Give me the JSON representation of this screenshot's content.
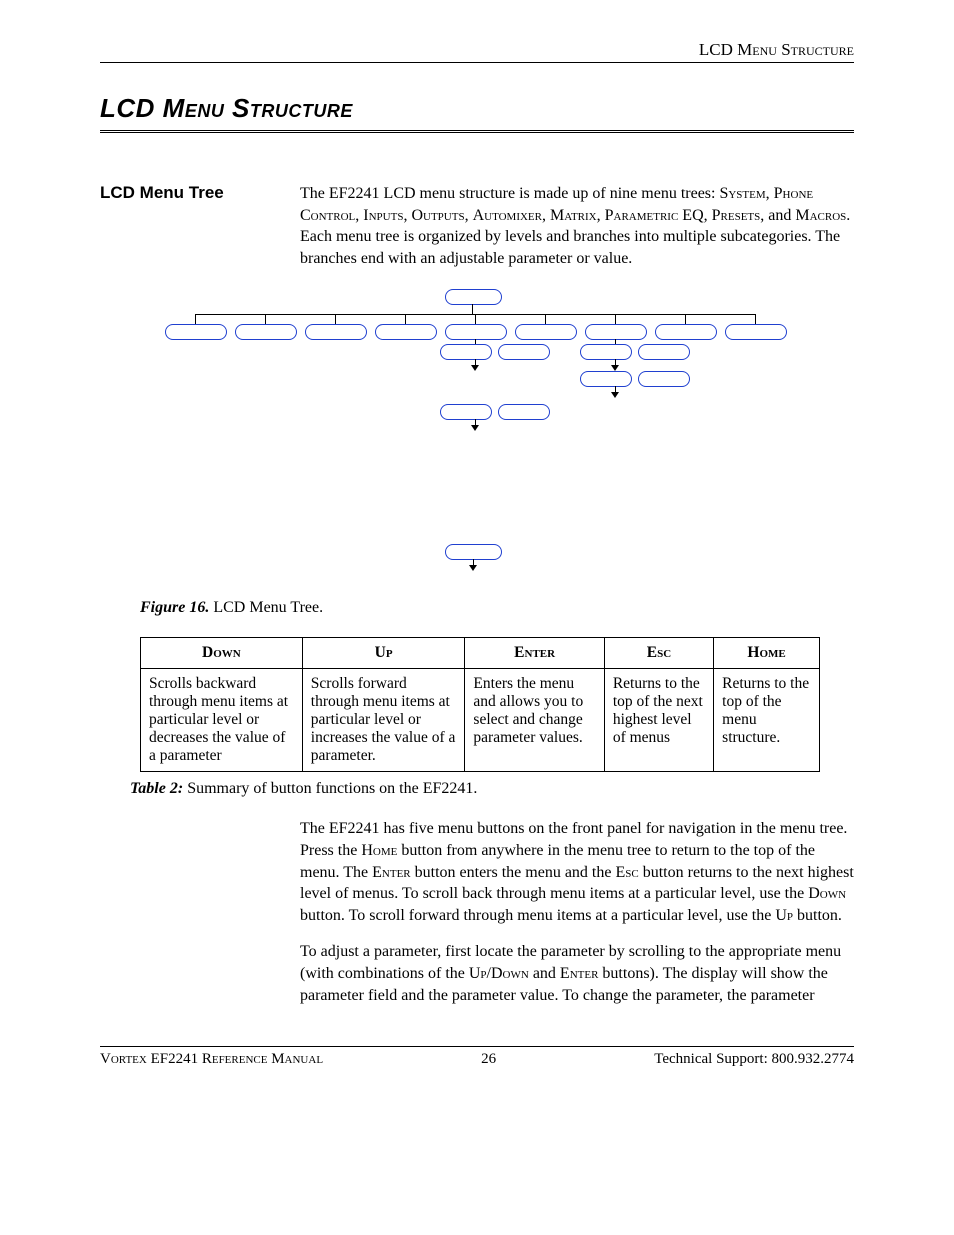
{
  "header": {
    "running_head": "LCD Menu Structure"
  },
  "chapter": {
    "title": "LCD Menu Structure"
  },
  "menu_tree": {
    "label": "LCD Menu Tree",
    "para_before_list": "The EF2241 LCD menu structure is made up of nine menu trees: ",
    "trees": [
      "System",
      "Phone Control",
      "Inputs",
      "Outputs",
      "Automixer",
      "Matrix",
      "Parametric EQ",
      "Presets",
      "Macros"
    ],
    "para_after_list": ".  Each menu tree is organized by levels and branches into multiple subcategories.  The branches end with an adjustable parameter or value."
  },
  "figure": {
    "label": "Figure 16.",
    "caption": " LCD Menu Tree."
  },
  "table": {
    "headers": [
      "Down",
      "Up",
      "Enter",
      "Esc",
      "Home"
    ],
    "cells": [
      "Scrolls backward through menu items at particular level or decreases the value of a parameter",
      "Scrolls forward through menu items at particular level or increases the value of a parameter.",
      "Enters the menu and allows you to select and change parameter values.",
      "Returns to the top of the next highest level of menus",
      "Returns to the top of the menu structure."
    ],
    "caption_label": "Table 2:",
    "caption_text": " Summary of button functions on the EF2241."
  },
  "paragraphs": {
    "p1a": "The EF2241 has five menu buttons on the front panel for navigation in the menu tree.  Press the ",
    "p1_home": "Home",
    "p1b": " button from anywhere in the menu tree to return to the top of the menu.  The ",
    "p1_enter": "Enter",
    "p1c": " button enters the menu and the ",
    "p1_esc": "Esc",
    "p1d": " button returns to the next highest level of menus.  To scroll back through menu items at a particular level, use the ",
    "p1_down": "Down",
    "p1e": " button.  To scroll forward through menu items at a particular level, use the ",
    "p1_up": "Up",
    "p1f": " button.",
    "p2a": "To adjust a parameter, first locate the parameter by scrolling to the appropriate menu (with combinations of the ",
    "p2_updown": "Up/Down",
    "p2b": " and ",
    "p2_enter": "Enter",
    "p2c": " buttons).  The display will show the parameter field and the parameter value.  To change the parameter, the parameter"
  },
  "footer": {
    "left": "Vortex EF2241 Reference Manual",
    "center": "26",
    "right": "Technical Support: 800.932.2774"
  }
}
